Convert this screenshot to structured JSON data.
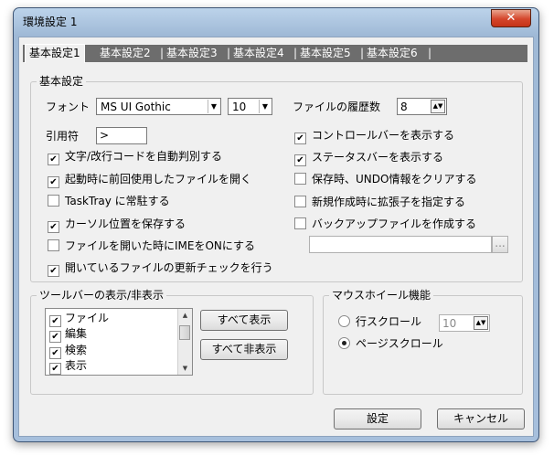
{
  "window": {
    "title": "環境設定 1",
    "close_glyph": "✕"
  },
  "tabs": [
    "基本設定1",
    "基本設定2",
    "基本設定3",
    "基本設定4",
    "基本設定5",
    "基本設定6"
  ],
  "tab_sep": "|",
  "basic": {
    "legend": "基本設定",
    "font_label": "フォント",
    "font_value": "MS UI Gothic",
    "size_value": "10",
    "history_label": "ファイルの履歴数",
    "history_value": "8",
    "quote_label": "引用符",
    "quote_value": ">",
    "left_checks": [
      {
        "label": "文字/改行コードを自動判別する",
        "checked": true
      },
      {
        "label": "起動時に前回使用したファイルを開く",
        "checked": true
      },
      {
        "label": "TaskTray に常駐する",
        "checked": false
      },
      {
        "label": "カーソル位置を保存する",
        "checked": true
      },
      {
        "label": "ファイルを開いた時にIMEをONにする",
        "checked": false
      },
      {
        "label": "開いているファイルの更新チェックを行う",
        "checked": true
      }
    ],
    "right_checks": [
      {
        "label": "コントロールバーを表示する",
        "checked": true
      },
      {
        "label": "ステータスバーを表示する",
        "checked": true
      },
      {
        "label": "保存時、UNDO情報をクリアする",
        "checked": false
      },
      {
        "label": "新規作成時に拡張子を指定する",
        "checked": false
      },
      {
        "label": "バックアップファイルを作成する",
        "checked": false
      }
    ],
    "backup_path": "",
    "browse_label": "..."
  },
  "toolbar": {
    "legend": "ツールバーの表示/非表示",
    "items": [
      {
        "label": "ファイル",
        "checked": true
      },
      {
        "label": "編集",
        "checked": true
      },
      {
        "label": "検索",
        "checked": true
      },
      {
        "label": "表示",
        "checked": true
      }
    ],
    "show_all": "すべて表示",
    "hide_all": "すべて非表示"
  },
  "mouse": {
    "legend": "マウスホイール機能",
    "line_scroll": "行スクロール",
    "line_value": "10",
    "page_scroll": "ページスクロール",
    "selected": "page"
  },
  "buttons": {
    "ok": "設定",
    "cancel": "キャンセル"
  },
  "glyphs": {
    "check": "✔",
    "dropdown": "▼",
    "spin": "▲▼",
    "scroll_up": "▲",
    "scroll_down": "▼"
  }
}
